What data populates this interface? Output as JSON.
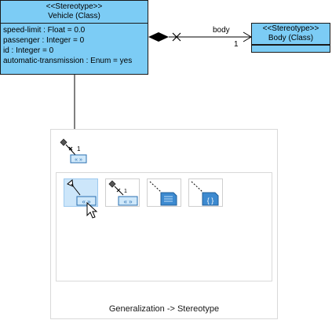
{
  "vehicle": {
    "stereotype": "<<Stereotype>>",
    "name": "Vehicle (Class)",
    "attributes": [
      "speed-limit : Float = 0.0",
      "passenger : Integer = 0",
      "id : Integer = 0",
      "automatic-transmission : Enum = yes"
    ]
  },
  "body": {
    "stereotype": "<<Stereotype>>",
    "name": "Body (Class)"
  },
  "association": {
    "role": "body",
    "multiplicity": "1"
  },
  "palette": {
    "preview_multiplicity": "1",
    "caption": "Generalization -> Stereotype",
    "options": [
      {
        "icon": "generalization-to-stereotype-icon",
        "selected": true
      },
      {
        "icon": "composition-to-stereotype-icon",
        "selected": false
      },
      {
        "icon": "note-icon",
        "selected": false
      },
      {
        "icon": "constraint-icon",
        "selected": false
      }
    ]
  },
  "colors": {
    "class_fill": "#7cccf5",
    "selection": "#cce6fa",
    "line": "#000000"
  }
}
